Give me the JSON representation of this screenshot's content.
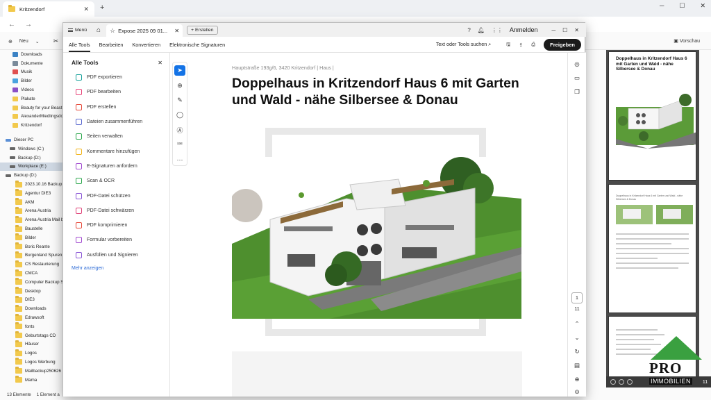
{
  "explorer": {
    "tab_title": "Kritzendorf",
    "new_button": "Neu",
    "preview_button": "Vorschau",
    "nav_items": [
      {
        "label": "Downloads",
        "color": "#3b82c4"
      },
      {
        "label": "Dokumente",
        "color": "#7a8a9a"
      },
      {
        "label": "Musik",
        "color": "#e05050"
      },
      {
        "label": "Bilder",
        "color": "#4aa3df"
      },
      {
        "label": "Videos",
        "color": "#8a4fc6"
      },
      {
        "label": "Plakate",
        "color": "#f2c94c"
      },
      {
        "label": "Beauty for your Beast",
        "color": "#f2c94c"
      },
      {
        "label": "AlexanderMiedlingsdo",
        "color": "#f2c94c"
      },
      {
        "label": "Kritzendorf",
        "color": "#f2c94c"
      }
    ],
    "nav_drives": [
      {
        "label": "Dieser PC",
        "color": "#5a8fd6",
        "selected": false
      },
      {
        "label": "Windows (C:)",
        "color": "#666",
        "selected": false
      },
      {
        "label": "Backup (D:)",
        "color": "#666",
        "selected": false
      },
      {
        "label": "Workplace (E:)",
        "color": "#666",
        "selected": true
      },
      {
        "label": "Backup (D:)",
        "color": "#666",
        "selected": false
      }
    ],
    "nav_folders": [
      "2023.10.16 Backup",
      "Agentur DIE3",
      "AKM",
      "Arena Austria",
      "Arena Austria Mail b",
      "Baustelle",
      "Bilder",
      "Boric Reante",
      "Burgenland Spuren",
      "CS Restaurierung",
      "CMCA",
      "Computer Backup S",
      "Desktop",
      "DIE3",
      "Downloads",
      "Edrawsoft",
      "fonts",
      "Geburtstags CD",
      "Häuser",
      "Logos",
      "Logos Werbung",
      "Mailbackup250626",
      "Mama"
    ],
    "status_count": "13 Elemente",
    "status_selected": "1 Element a"
  },
  "acrobat": {
    "menu_label": "Menü",
    "doc_tab": "Expose 2025 09 01...",
    "create_label": "Erstellen",
    "login_label": "Anmelden",
    "tabs": [
      "Alle Tools",
      "Bearbeiten",
      "Konvertieren",
      "Elektronische Signaturen"
    ],
    "search_label": "Text oder Tools suchen",
    "share_label": "Freigeben",
    "panel_title": "Alle Tools",
    "tools": [
      {
        "label": "PDF exportieren",
        "color": "#1ba39c"
      },
      {
        "label": "PDF bearbeiten",
        "color": "#e8457a"
      },
      {
        "label": "PDF erstellen",
        "color": "#e64b3c"
      },
      {
        "label": "Dateien zusammenführen",
        "color": "#5b6ad0"
      },
      {
        "label": "Seiten verwalten",
        "color": "#2fa84f"
      },
      {
        "label": "Kommentare hinzufügen",
        "color": "#f2b51d"
      },
      {
        "label": "E-Signaturen anfordern",
        "color": "#a24bd0"
      },
      {
        "label": "Scan & OCR",
        "color": "#2fa84f"
      },
      {
        "label": "PDF-Datei schützen",
        "color": "#8a55d6"
      },
      {
        "label": "PDF-Datei schwärzen",
        "color": "#e0457a"
      },
      {
        "label": "PDF komprimieren",
        "color": "#e64b3c"
      },
      {
        "label": "Formular vorbereiten",
        "color": "#a24bd0"
      },
      {
        "label": "Ausfüllen und Signieren",
        "color": "#8a55d6"
      }
    ],
    "more_link": "Mehr anzeigen",
    "breadcrumb": "Hauptstraße 193g/6, 3420 Kritzendorf   |   Haus   |",
    "doc_title": "Doppelhaus in Kritzendorf Haus 6 mit Garten und Wald -  nähe Silbersee & Donau",
    "page_current": "1",
    "page_total": "11"
  },
  "preview": {
    "title": "Doppelhaus in Kritzendorf Haus 6 mit Garten und Wald - nähe Silbersee & Donau",
    "page2_text": "Doppelhaus in Kritzendorf Haus 6 mit Garten und Wald - nähe Silbersee & Donau",
    "page_count": "11"
  },
  "logo": {
    "pro": "PRO",
    "immobilien": "IMMOBILIEN",
    "brand_color": "#3aa040"
  }
}
